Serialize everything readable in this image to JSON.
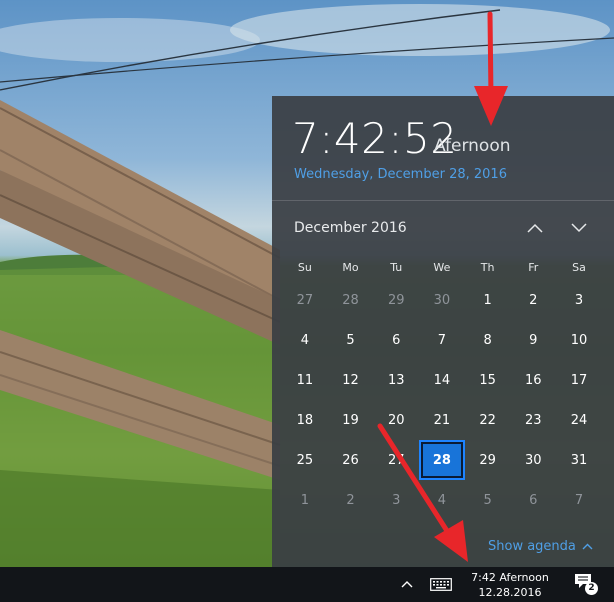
{
  "flyout": {
    "time": "7:42:52",
    "period": "Afernoon",
    "date_long": "Wednesday, December 28, 2016",
    "month_title": "December 2016",
    "days_of_week": [
      "Su",
      "Mo",
      "Tu",
      "We",
      "Th",
      "Fr",
      "Sa"
    ],
    "weeks": [
      [
        {
          "d": "27",
          "o": true
        },
        {
          "d": "28",
          "o": true
        },
        {
          "d": "29",
          "o": true
        },
        {
          "d": "30",
          "o": true
        },
        {
          "d": "1"
        },
        {
          "d": "2"
        },
        {
          "d": "3"
        }
      ],
      [
        {
          "d": "4"
        },
        {
          "d": "5"
        },
        {
          "d": "6"
        },
        {
          "d": "7"
        },
        {
          "d": "8"
        },
        {
          "d": "9"
        },
        {
          "d": "10"
        }
      ],
      [
        {
          "d": "11"
        },
        {
          "d": "12"
        },
        {
          "d": "13"
        },
        {
          "d": "14"
        },
        {
          "d": "15"
        },
        {
          "d": "16"
        },
        {
          "d": "17"
        }
      ],
      [
        {
          "d": "18"
        },
        {
          "d": "19"
        },
        {
          "d": "20"
        },
        {
          "d": "21"
        },
        {
          "d": "22"
        },
        {
          "d": "23"
        },
        {
          "d": "24"
        }
      ],
      [
        {
          "d": "25"
        },
        {
          "d": "26"
        },
        {
          "d": "27"
        },
        {
          "d": "28",
          "today": true
        },
        {
          "d": "29"
        },
        {
          "d": "30"
        },
        {
          "d": "31"
        }
      ],
      [
        {
          "d": "1",
          "o": true
        },
        {
          "d": "2",
          "o": true
        },
        {
          "d": "3",
          "o": true
        },
        {
          "d": "4",
          "o": true
        },
        {
          "d": "5",
          "o": true
        },
        {
          "d": "6",
          "o": true
        },
        {
          "d": "7",
          "o": true
        }
      ]
    ],
    "show_agenda_label": "Show agenda",
    "nav_icons": [
      "chevron-up-icon",
      "chevron-down-icon"
    ]
  },
  "taskbar": {
    "clock_time": "7:42 Afernoon",
    "clock_date": "12.28.2016",
    "notification_count": "2",
    "icons": [
      "chevron-up-icon",
      "keyboard-icon",
      "notification-icon"
    ]
  },
  "colors": {
    "accent": "#1874d9",
    "link": "#4f9fe6",
    "flyout_bg": "#3a3e44",
    "taskbar_bg": "#121519",
    "annotation": "#e8262a"
  }
}
